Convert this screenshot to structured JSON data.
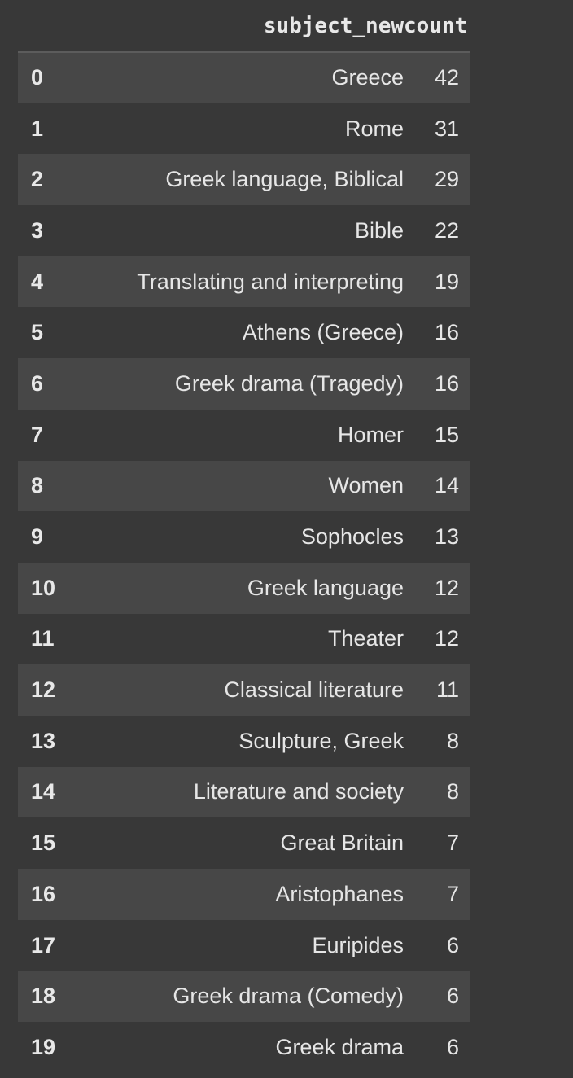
{
  "table": {
    "columns": [
      "subject_new",
      "count"
    ],
    "rows": [
      {
        "index": "0",
        "subject_new": "Greece",
        "count": "42"
      },
      {
        "index": "1",
        "subject_new": "Rome",
        "count": "31"
      },
      {
        "index": "2",
        "subject_new": "Greek language, Biblical",
        "count": "29"
      },
      {
        "index": "3",
        "subject_new": "Bible",
        "count": "22"
      },
      {
        "index": "4",
        "subject_new": "Translating and interpreting",
        "count": "19"
      },
      {
        "index": "5",
        "subject_new": "Athens (Greece)",
        "count": "16"
      },
      {
        "index": "6",
        "subject_new": "Greek drama (Tragedy)",
        "count": "16"
      },
      {
        "index": "7",
        "subject_new": "Homer",
        "count": "15"
      },
      {
        "index": "8",
        "subject_new": "Women",
        "count": "14"
      },
      {
        "index": "9",
        "subject_new": "Sophocles",
        "count": "13"
      },
      {
        "index": "10",
        "subject_new": "Greek language",
        "count": "12"
      },
      {
        "index": "11",
        "subject_new": "Theater",
        "count": "12"
      },
      {
        "index": "12",
        "subject_new": "Classical literature",
        "count": "11"
      },
      {
        "index": "13",
        "subject_new": "Sculpture, Greek",
        "count": "8"
      },
      {
        "index": "14",
        "subject_new": "Literature and society",
        "count": "8"
      },
      {
        "index": "15",
        "subject_new": "Great Britain",
        "count": "7"
      },
      {
        "index": "16",
        "subject_new": "Aristophanes",
        "count": "7"
      },
      {
        "index": "17",
        "subject_new": "Euripides",
        "count": "6"
      },
      {
        "index": "18",
        "subject_new": "Greek drama (Comedy)",
        "count": "6"
      },
      {
        "index": "19",
        "subject_new": "Greek drama",
        "count": "6"
      }
    ]
  },
  "colors": {
    "background": "#383838",
    "row_stripe": "#474747",
    "text": "#e6e6e6"
  }
}
